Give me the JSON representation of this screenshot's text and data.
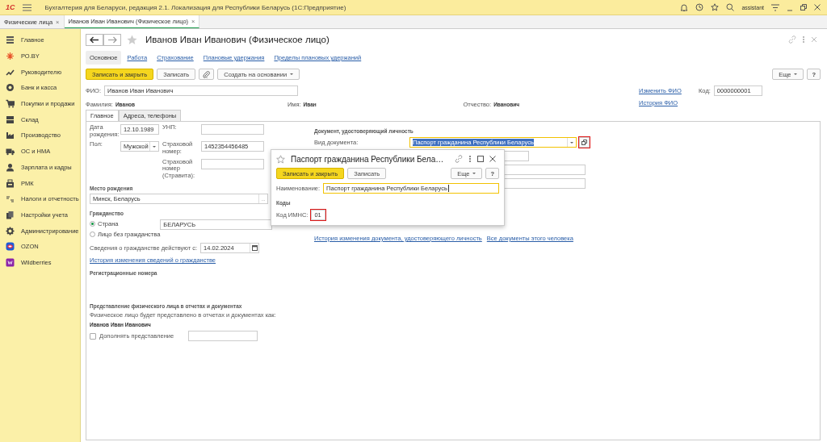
{
  "app": {
    "logo": "1С",
    "title": "Бухгалтерия для Беларуси, редакция 2.1. Локализация для Республики Беларусь  (1С:Предприятие)",
    "user": "assistant"
  },
  "open_tabs": [
    {
      "label": "Физические лица",
      "selected": false,
      "close": "×"
    },
    {
      "label": "Иванов Иван Иванович (Физическое лицо)",
      "selected": true,
      "close": "×"
    }
  ],
  "sidebar": {
    "items": [
      {
        "label": "Главное"
      },
      {
        "label": "РО.BY"
      },
      {
        "label": "Руководителю"
      },
      {
        "label": "Банк и касса"
      },
      {
        "label": "Покупки и продажи"
      },
      {
        "label": "Склад"
      },
      {
        "label": "Производство"
      },
      {
        "label": "ОС и НМА"
      },
      {
        "label": "Зарплата и кадры"
      },
      {
        "label": "РМК"
      },
      {
        "label": "Налоги и отчетность"
      },
      {
        "label": "Настройки учета"
      },
      {
        "label": "Администрирование"
      },
      {
        "label": "OZON"
      },
      {
        "label": "Wildberries"
      }
    ]
  },
  "form": {
    "title": "Иванов Иван Иванович (Физическое лицо)",
    "nav": [
      {
        "label": "Основное",
        "selected": true
      },
      {
        "label": "Работа",
        "selected": false
      },
      {
        "label": "Страхование",
        "selected": false
      },
      {
        "label": "Плановые удержания",
        "selected": false
      },
      {
        "label": "Пределы плановых удержаний",
        "selected": false
      }
    ],
    "toolbar": {
      "primary": "Записать и закрыть",
      "save": "Записать",
      "create_based": "Создать на основании",
      "more": "Еще",
      "help": "?"
    },
    "fio": {
      "label": "ФИО:",
      "value": "Иванов Иван Иванович"
    },
    "surname": {
      "label": "Фамилия:",
      "value": "Иванов"
    },
    "name": {
      "label": "Имя:",
      "value": "Иван"
    },
    "patronymic": {
      "label": "Отчество:",
      "value": "Иванович"
    },
    "change_fio_link": "Изменить ФИО",
    "history_fio_link": "История ФИО",
    "code": {
      "label": "Код:",
      "value": "0000000001"
    },
    "inner_tabs": [
      {
        "label": "Главное",
        "selected": true
      },
      {
        "label": "Адреса, телефоны",
        "selected": false
      }
    ],
    "main": {
      "birth_date": {
        "label": "Дата рождения:",
        "value": "12.10.1989"
      },
      "unp": {
        "label": "УНП:"
      },
      "gender": {
        "label": "Пол:",
        "value": "Мужской"
      },
      "insurance_number": {
        "label": "Страховой номер:",
        "value": "1452354456485"
      },
      "insurance_number_stravita": {
        "label": "Страховой номер (Стравита):"
      },
      "birth_place": {
        "heading": "Место рождения",
        "value": "Минск, Беларусь",
        "button": "..."
      },
      "citizenship": {
        "heading": "Гражданство",
        "options": [
          {
            "label": "Страна",
            "selected": true
          },
          {
            "label": "Лицо без гражданства",
            "selected": false
          }
        ],
        "country": "БЕЛАРУСЬ"
      },
      "citizenship_date": {
        "label": "Сведения о гражданстве действуют с:",
        "value": "14.02.2024"
      },
      "citizenship_history_link": "История изменения сведений о гражданстве",
      "registration_heading": "Регистрационные номера",
      "presentation": {
        "heading": "Представление физического лица в отчетах и документах",
        "text": "Физическое лицо будет представлено в отчетах и документах как:",
        "value": "Иванов Иван Иванович",
        "checkbox": {
          "label": "Дополнять представление",
          "checked": false
        }
      }
    },
    "document": {
      "heading": "Документ, удостоверяющий личность",
      "kind": {
        "label": "Вид документа:",
        "value": "Паспорт гражданина Республики Беларусь",
        "focused": true,
        "open_highlighted": true
      },
      "links": [
        "История изменения документа, удостоверяющего личность",
        "Все документы этого человека"
      ]
    }
  },
  "dialog": {
    "title": "Паспорт гражданина Республики Бела…",
    "toolbar": {
      "primary": "Записать и закрыть",
      "save": "Записать",
      "more": "Еще",
      "help": "?"
    },
    "name": {
      "label": "Наименование:",
      "value": "Паспорт гражданина Республики Беларусь",
      "focused": true
    },
    "codes_heading": "Коды",
    "imns": {
      "label": "Код ИМНС:",
      "value": "01",
      "highlighted": true
    }
  }
}
